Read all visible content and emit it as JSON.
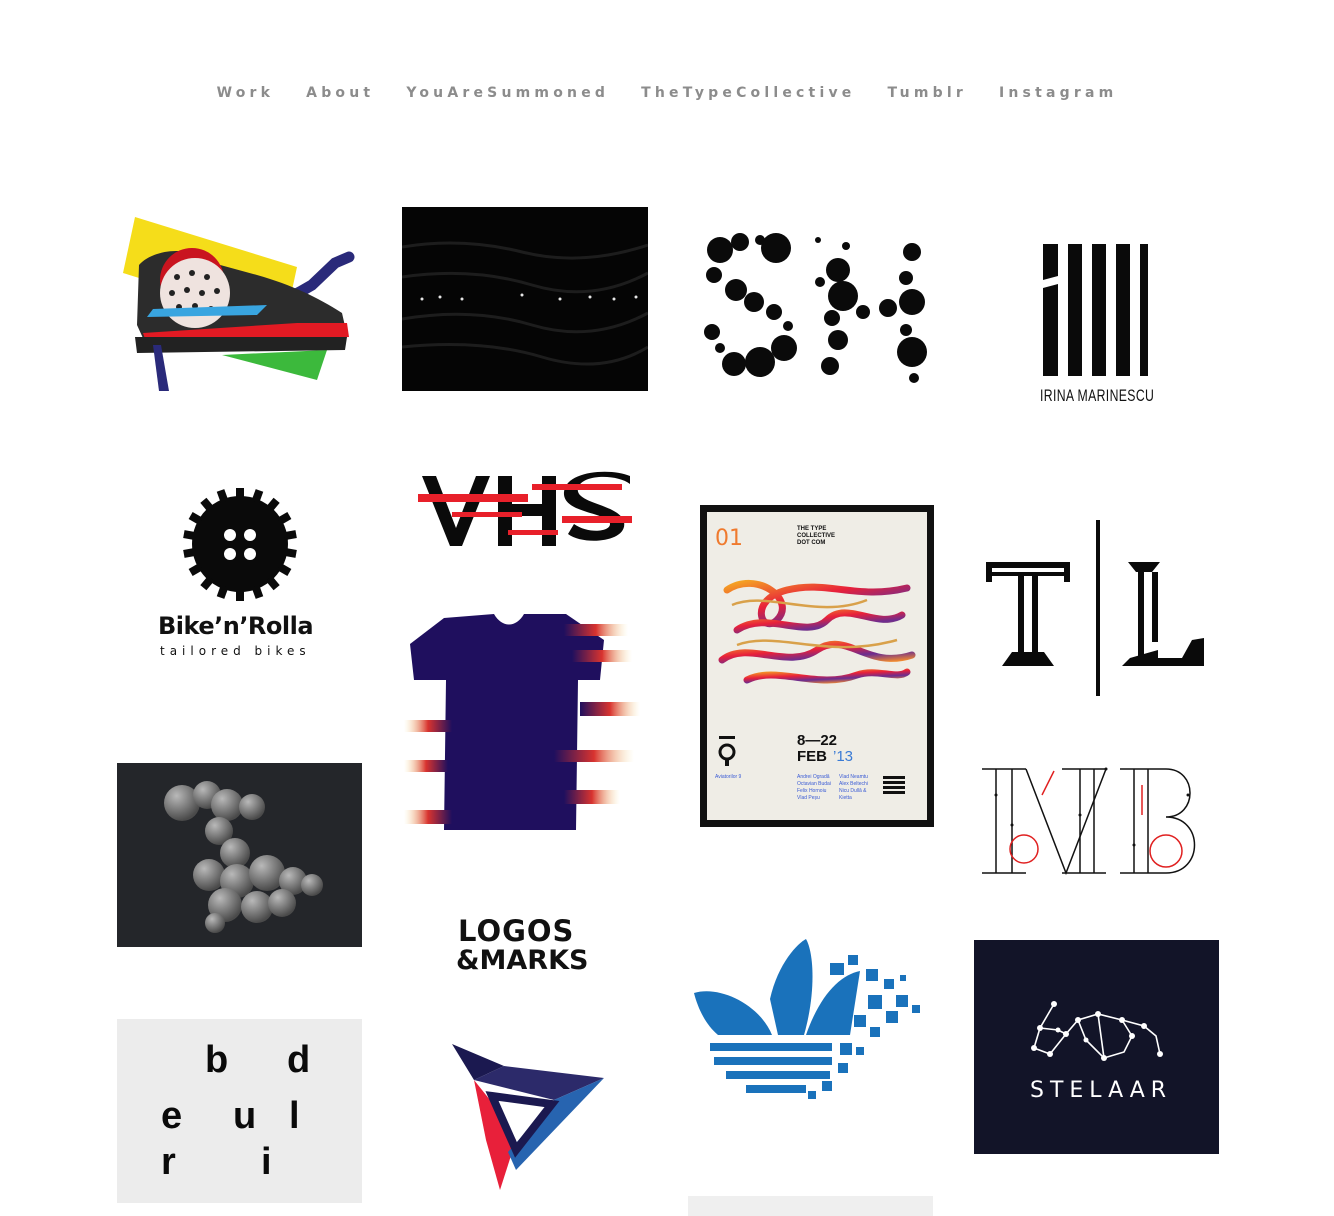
{
  "nav": {
    "items": [
      "Work",
      "About",
      "YouAreSummoned",
      "TheTypeCollective",
      "Tumblr",
      "Instagram"
    ]
  },
  "tiles": {
    "irina": {
      "text": "IRINA MARINESCU"
    },
    "bike": {
      "brand": "Bike’n’Rolla",
      "tagline": "tailored bikes"
    },
    "poster": {
      "number": "01",
      "org": [
        "THE TYPE",
        "COLLECTIVE",
        "DOT COM"
      ],
      "dates": "8—22",
      "month": "FEB",
      "year": "’13",
      "venue": "Aviatorilor 9",
      "names1": [
        "Andrei Ogradă",
        "Octavian Budai",
        "Felix Hornoiu",
        "Vlad Peșu"
      ],
      "names2": [
        "Vlad Neamtu",
        "Alex Beltechi",
        "Nicu Dullă &",
        "Kietta"
      ]
    },
    "logos": {
      "line1": "LOGOS",
      "line2": "&MARKS"
    },
    "stelaar": {
      "text": "STELAAR"
    },
    "letters": {
      "l1": "b",
      "l2": "d",
      "l3": "e",
      "l4": "u",
      "l5": "l",
      "l6": "r",
      "l7": "i"
    }
  },
  "colors": {
    "nav": "#8c8c8c",
    "navy": "#121428",
    "adidas": "#1a72bb",
    "tshirt": "#1f0f5e"
  }
}
